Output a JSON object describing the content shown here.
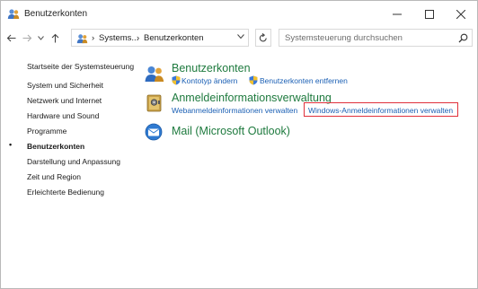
{
  "window": {
    "title": "Benutzerkonten"
  },
  "address": {
    "crumbs": [
      "Systems...",
      "Benutzerkonten"
    ]
  },
  "search": {
    "placeholder": "Systemsteuerung durchsuchen"
  },
  "sidebar": {
    "items": [
      {
        "label": "Startseite der Systemsteuerung",
        "active": false
      },
      {
        "label": "System und Sicherheit",
        "active": false
      },
      {
        "label": "Netzwerk und Internet",
        "active": false
      },
      {
        "label": "Hardware und Sound",
        "active": false
      },
      {
        "label": "Programme",
        "active": false
      },
      {
        "label": "Benutzerkonten",
        "active": true
      },
      {
        "label": "Darstellung und Anpassung",
        "active": false
      },
      {
        "label": "Zeit und Region",
        "active": false
      },
      {
        "label": "Erleichterte Bedienung",
        "active": false
      }
    ]
  },
  "main": {
    "categories": [
      {
        "title": "Benutzerkonten",
        "icon": "users-icon",
        "links": [
          "Kontotyp ändern",
          "Benutzerkonten entfernen"
        ]
      },
      {
        "title": "Anmeldeinformationsverwaltung",
        "icon": "credential-vault-icon",
        "links": [
          "Webanmeldeinformationen verwalten",
          "Windows-Anmeldeinformationen verwalten"
        ]
      },
      {
        "title": "Mail (Microsoft Outlook)",
        "icon": "mail-icon",
        "links": []
      }
    ]
  },
  "colors": {
    "category_title": "#1e7a3e",
    "link": "#1a5fb4",
    "highlight": "#e0303a"
  }
}
